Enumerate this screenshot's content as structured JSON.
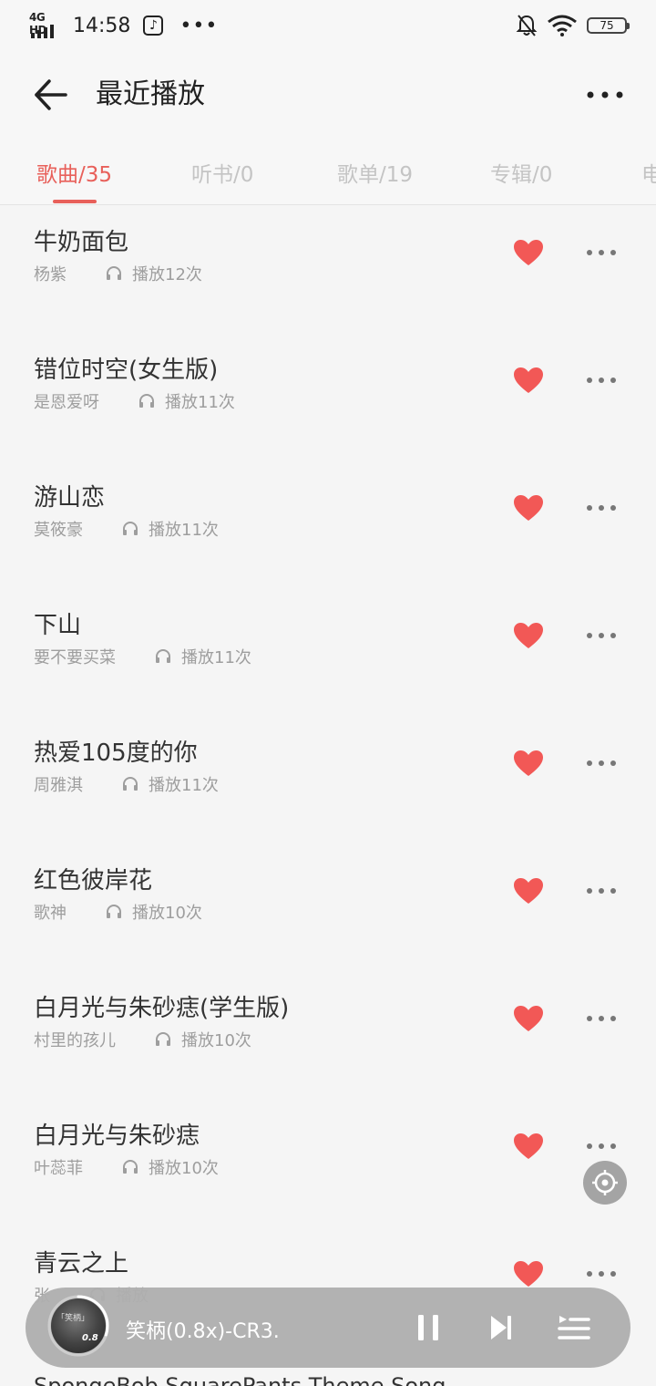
{
  "status_bar": {
    "network": "4G HD",
    "time": "14:58",
    "battery": "75",
    "icons": [
      "signal-icon",
      "music-note-icon",
      "more-dots-icon",
      "mute-bell-icon",
      "wifi-icon",
      "battery-icon"
    ]
  },
  "header": {
    "title": "最近播放"
  },
  "tabs": [
    {
      "label": "歌曲/35",
      "active": true
    },
    {
      "label": "听书/0",
      "active": false
    },
    {
      "label": "歌单/19",
      "active": false
    },
    {
      "label": "专辑/0",
      "active": false
    },
    {
      "label": "电",
      "active": false
    }
  ],
  "songs": [
    {
      "title": "牛奶面包",
      "artist": "杨紫",
      "plays": "播放12次"
    },
    {
      "title": "错位时空(女生版)",
      "artist": "是恩爱呀",
      "plays": "播放11次"
    },
    {
      "title": "游山恋",
      "artist": "莫筱豪",
      "plays": "播放11次"
    },
    {
      "title": "下山",
      "artist": "要不要买菜",
      "plays": "播放11次"
    },
    {
      "title": "热爱105度的你",
      "artist": "周雅淇",
      "plays": "播放11次"
    },
    {
      "title": "红色彼岸花",
      "artist": "歌神",
      "plays": "播放10次"
    },
    {
      "title": "白月光与朱砂痣(学生版)",
      "artist": "村里的孩儿",
      "plays": "播放10次"
    },
    {
      "title": "白月光与朱砂痣",
      "artist": "叶蕊菲",
      "plays": "播放10次"
    },
    {
      "title": "青云之上",
      "artist": "张",
      "plays": "播放"
    }
  ],
  "player": {
    "title": "笑柄(0.8x)-CR3.",
    "cover_text": "「笑柄」",
    "cover_badge": "0.8",
    "progress": 0.3
  },
  "peek_text": "SpongeBob SquarePants Theme Song",
  "colors": {
    "accent": "#e8605a",
    "heart": "#f25856"
  }
}
